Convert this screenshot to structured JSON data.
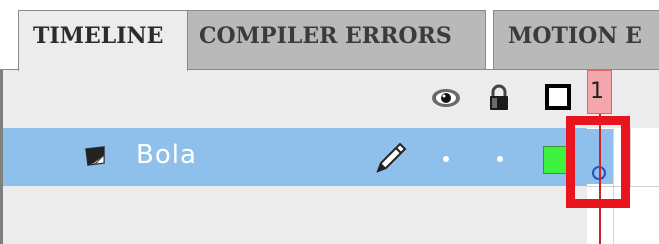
{
  "tabs": [
    {
      "label": "TIMELINE",
      "active": true
    },
    {
      "label": "COMPILER ERRORS",
      "active": false
    },
    {
      "label": "MOTION E",
      "active": false
    }
  ],
  "timeline": {
    "frame_number": "1",
    "header_icons": [
      "eye-icon",
      "lock-icon",
      "outline-icon"
    ],
    "layer": {
      "name": "Bola",
      "icon": "layer-icon",
      "edit_icon": "pencil-icon",
      "outline_color": "#3cf23c",
      "keyframe": "empty-keyframe"
    }
  },
  "colors": {
    "selected_row": "#8fc0ec",
    "highlight": "#e8141e",
    "playhead": "#d0202a"
  }
}
